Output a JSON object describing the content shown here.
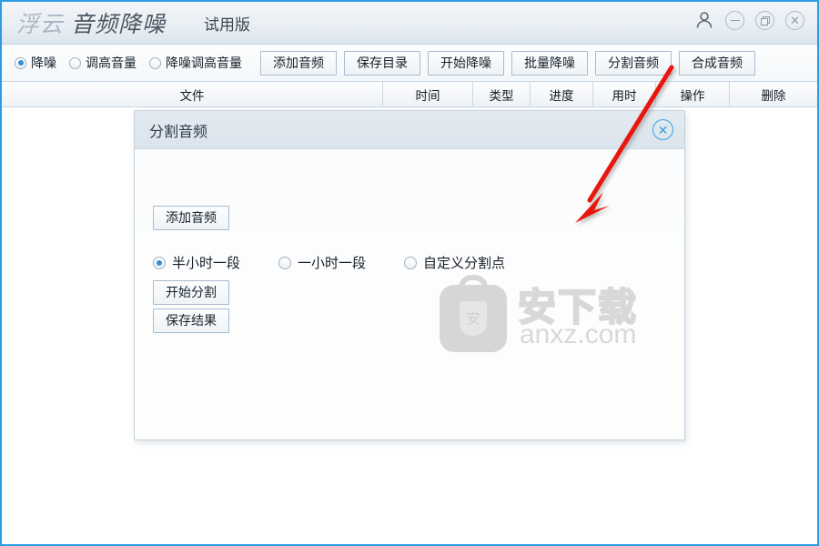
{
  "window": {
    "brand_prefix": "浮云",
    "brand_name": "音频降噪",
    "trial_label": "试用版",
    "accent_color": "#2e9ce0",
    "border_color": "#2e9ce0"
  },
  "titlebar_icons": {
    "account": "user-icon",
    "minimize": "minimize-icon",
    "restore": "restore-icon",
    "close": "close-icon",
    "close_glyph": "✕"
  },
  "toolbar": {
    "modes": [
      {
        "label": "降噪",
        "selected": true
      },
      {
        "label": "调高音量",
        "selected": false
      },
      {
        "label": "降噪调高音量",
        "selected": false
      }
    ],
    "buttons": [
      {
        "label": "添加音频",
        "name": "add-audio-button"
      },
      {
        "label": "保存目录",
        "name": "save-directory-button"
      },
      {
        "label": "开始降噪",
        "name": "start-denoise-button"
      },
      {
        "label": "批量降噪",
        "name": "batch-denoise-button"
      },
      {
        "label": "分割音频",
        "name": "split-audio-button"
      },
      {
        "label": "合成音频",
        "name": "merge-audio-button"
      }
    ]
  },
  "table": {
    "columns": [
      {
        "label": "文件"
      },
      {
        "label": "时间"
      },
      {
        "label": "类型"
      },
      {
        "label": "进度"
      },
      {
        "label": "用时"
      },
      {
        "label": "操作"
      },
      {
        "label": "删除"
      }
    ],
    "rows": []
  },
  "dialog": {
    "title": "分割音频",
    "close_glyph": "✕",
    "add_audio_label": "添加音频",
    "split_modes": [
      {
        "label": "半小时一段",
        "selected": true
      },
      {
        "label": "一小时一段",
        "selected": false
      },
      {
        "label": "自定义分割点",
        "selected": false
      }
    ],
    "start_split_label": "开始分割",
    "save_result_label": "保存结果"
  },
  "watermark": {
    "shield_char": "安",
    "brand_cn": "安下载",
    "url": "anxz.com",
    "color": "#d8d8d8"
  },
  "annotation": {
    "arrow_color": "#e8140c",
    "points_from": "split-audio-button",
    "points_to": "dialog-body"
  }
}
